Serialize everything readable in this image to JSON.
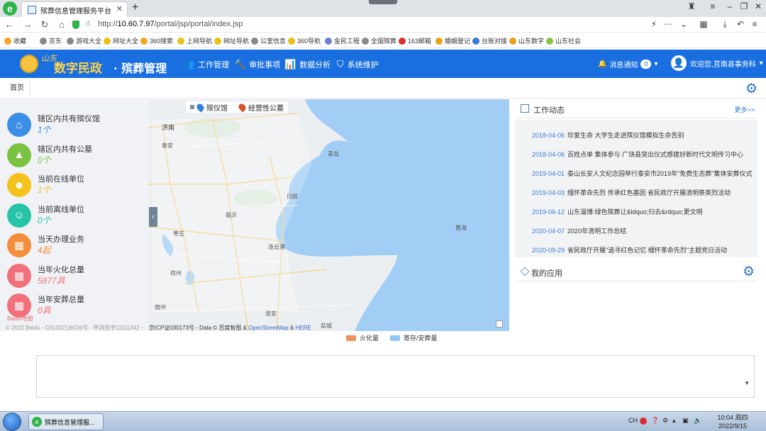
{
  "browser": {
    "tab_title": "殡葬信息管理服务平台",
    "url_prefix": "http://",
    "url_host": "10.60.7.97",
    "url_path": "/portal/jsp/portal/index.jsp",
    "bookmarks": [
      {
        "label": "收藏",
        "color": "#f5a623"
      },
      {
        "label": "京东",
        "color": "#888888"
      },
      {
        "label": "游戏大全",
        "color": "#888888"
      },
      {
        "label": "网址大全",
        "color": "#e8c21a"
      },
      {
        "label": "360搜索",
        "color": "#f5a623"
      },
      {
        "label": "上网导航",
        "color": "#e8c21a"
      },
      {
        "label": "网址导航",
        "color": "#e8c21a"
      },
      {
        "label": "公室信息",
        "color": "#888888"
      },
      {
        "label": "360导航",
        "color": "#e8c21a"
      },
      {
        "label": "金民工程",
        "color": "#6d7fd1"
      },
      {
        "label": "全国殡葬",
        "color": "#888888"
      },
      {
        "label": "163邮箱",
        "color": "#d8302f"
      },
      {
        "label": "婚姻登记",
        "color": "#e8a21a"
      },
      {
        "label": "台账对接",
        "color": "#3a7bd5"
      },
      {
        "label": "山东数字",
        "color": "#e8a21a"
      },
      {
        "label": "山东社会",
        "color": "#8bc34a"
      }
    ]
  },
  "header": {
    "brand_small": "山东",
    "brand_main": "数字民政",
    "brand_sub": "· 殡葬管理",
    "menu": [
      {
        "label": "工作管理",
        "icon": "users-icon",
        "glyph": "👥"
      },
      {
        "label": "审批事项",
        "icon": "gavel-icon",
        "glyph": "🔨"
      },
      {
        "label": "数据分析",
        "icon": "bar-chart-icon",
        "glyph": "📊"
      },
      {
        "label": "系统维护",
        "icon": "shield-icon",
        "glyph": "⛉"
      }
    ],
    "notify_label": "消息通知",
    "notify_count": "0",
    "user_label": "欢迎您,莒南县事务科"
  },
  "breadcrumb": {
    "home": "首页"
  },
  "map": {
    "legend_funeral_home": "殡仪馆",
    "legend_cemetery": "经营性公墓",
    "copyright_left": "© 2022 Baidu - GS(2021)6026号 - 甲测资字11111342 -",
    "copyright_right_prefix": "京ICP证030173号 - Data © 百度智图 &",
    "osm": "OpenStreetMap",
    "amp": "&",
    "here": "HERE",
    "place_labels": [
      "济南",
      "泰安",
      "青岛",
      "日照",
      "临沂",
      "枣庄",
      "连云港",
      "黄海",
      "徐州",
      "宿州",
      "淮安",
      "盐城"
    ]
  },
  "stats": [
    {
      "label": "辖区内共有殡仪馆",
      "value": "1个",
      "color": "#3a8ee6",
      "icon": "home-icon",
      "glyph": "⌂"
    },
    {
      "label": "辖区内共有公墓",
      "value": "0个",
      "color": "#7cc242",
      "icon": "mountain-icon",
      "glyph": "▲"
    },
    {
      "label": "当前在线单位",
      "value": "1个",
      "color": "#f4c21a",
      "icon": "person-online-icon",
      "glyph": "☻"
    },
    {
      "label": "当前离线单位",
      "value": "0个",
      "color": "#26c4a6",
      "icon": "person-offline-icon",
      "glyph": "☺"
    },
    {
      "label": "当天办理业务",
      "value": "4起",
      "color": "#f38d3b",
      "icon": "calendar-icon",
      "glyph": "▦"
    },
    {
      "label": "当年火化总量",
      "value": "5877具",
      "color": "#f2707a",
      "icon": "calendar-icon",
      "glyph": "▦"
    },
    {
      "label": "当年安葬总量",
      "value": "0具",
      "color": "#f2707a",
      "icon": "calendar-icon",
      "glyph": "▦"
    }
  ],
  "chart_legend": [
    {
      "label": "火化量",
      "color": "#f38d5a"
    },
    {
      "label": "寄存/安葬量",
      "color": "#8ec8f5"
    }
  ],
  "news": {
    "title": "工作动态",
    "more": "更多>>",
    "items": [
      {
        "date": "2018-04-06",
        "text": "珍爱生命 大学生走进殡仪馆模拟生命告别"
      },
      {
        "date": "2018-04-06",
        "text": "百姓点单 集体参与 广饶县突出仪式感建好新时代文明传习中心"
      },
      {
        "date": "2019-04-01",
        "text": "泰山长安人文纪念园举行泰安市2019年\"免费生态葬\"集体安葬仪式"
      },
      {
        "date": "2019-04-03",
        "text": "缅怀革命先烈 传承红色基因 省民政厅开展清明祭英烈活动"
      },
      {
        "date": "2019-06-12",
        "text": "山东淄博:绿色殡葬让&ldquo;归去&rdquo;更文明"
      },
      {
        "date": "2020-04-07",
        "text": "2020年清明工作总结"
      },
      {
        "date": "2020-09-29",
        "text": "省民政厅开展\"追寻红色记忆 缅怀革命先烈\"主题党日活动"
      }
    ]
  },
  "apps": {
    "title": "我的应用"
  },
  "taskbar": {
    "task_label": "殡葬信息管理服...",
    "tray_lang": "CH",
    "time": "10:04 周四",
    "date": "2022/9/15"
  }
}
